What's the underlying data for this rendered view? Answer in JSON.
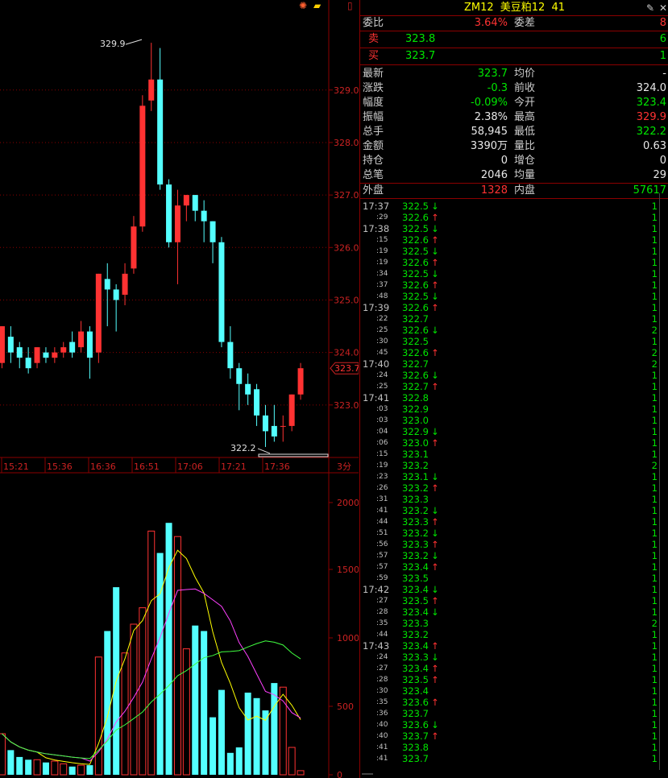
{
  "toolbar": {
    "icons": [
      "settings-icon",
      "gold-icon",
      "menu-icon"
    ]
  },
  "header": {
    "code": "ZM12",
    "name": "美豆粕12",
    "count": "41"
  },
  "order_book": {
    "ratio_label": "委比",
    "ratio_value": "3.64%",
    "diff_label": "委差",
    "diff_value": "8",
    "sell_label": "卖",
    "sell_price": "323.8",
    "sell_vol": "6",
    "buy_label": "买",
    "buy_price": "323.7",
    "buy_vol": "1"
  },
  "quote": [
    {
      "l1": "最新",
      "v1": "323.7",
      "c1": "green",
      "l2": "均价",
      "v2": "-",
      "c2": "white"
    },
    {
      "l1": "涨跌",
      "v1": "-0.3",
      "c1": "green",
      "l2": "前收",
      "v2": "324.0",
      "c2": "white"
    },
    {
      "l1": "幅度",
      "v1": "-0.09%",
      "c1": "green",
      "l2": "今开",
      "v2": "323.4",
      "c2": "green"
    },
    {
      "l1": "振幅",
      "v1": "2.38%",
      "c1": "white",
      "l2": "最高",
      "v2": "329.9",
      "c2": "red"
    },
    {
      "l1": "总手",
      "v1": "58,945",
      "c1": "white",
      "l2": "最低",
      "v2": "322.2",
      "c2": "green"
    },
    {
      "l1": "金额",
      "v1": "3390万",
      "c1": "white",
      "l2": "量比",
      "v2": "0.63",
      "c2": "white"
    },
    {
      "l1": "持仓",
      "v1": "0",
      "c1": "white",
      "l2": "增仓",
      "v2": "0",
      "c2": "white"
    },
    {
      "l1": "总笔",
      "v1": "2046",
      "c1": "white",
      "l2": "均量",
      "v2": "29",
      "c2": "white"
    }
  ],
  "outer_inner": {
    "outer_label": "外盘",
    "outer_value": "1328",
    "inner_label": "内盘",
    "inner_value": "57617"
  },
  "ticks": [
    {
      "t": "17:37",
      "p": "322.5",
      "d": "↓",
      "v": "1"
    },
    {
      "t": ":29",
      "p": "322.6",
      "d": "↑",
      "v": "1"
    },
    {
      "t": "17:38",
      "p": "322.5",
      "d": "↓",
      "v": "1"
    },
    {
      "t": ":15",
      "p": "322.6",
      "d": "↑",
      "v": "1"
    },
    {
      "t": ":19",
      "p": "322.5",
      "d": "↓",
      "v": "1"
    },
    {
      "t": ":19",
      "p": "322.6",
      "d": "↑",
      "v": "1"
    },
    {
      "t": ":34",
      "p": "322.5",
      "d": "↓",
      "v": "1"
    },
    {
      "t": ":37",
      "p": "322.6",
      "d": "↑",
      "v": "1"
    },
    {
      "t": ":48",
      "p": "322.5",
      "d": "↓",
      "v": "1"
    },
    {
      "t": "17:39",
      "p": "322.6",
      "d": "↑",
      "v": "1"
    },
    {
      "t": ":22",
      "p": "322.7",
      "d": "",
      "v": "1"
    },
    {
      "t": ":25",
      "p": "322.6",
      "d": "↓",
      "v": "2"
    },
    {
      "t": ":30",
      "p": "322.5",
      "d": "",
      "v": "1"
    },
    {
      "t": ":45",
      "p": "322.6",
      "d": "↑",
      "v": "2"
    },
    {
      "t": "17:40",
      "p": "322.7",
      "d": "",
      "v": "2"
    },
    {
      "t": ":24",
      "p": "322.6",
      "d": "↓",
      "v": "1"
    },
    {
      "t": ":25",
      "p": "322.7",
      "d": "↑",
      "v": "1"
    },
    {
      "t": "17:41",
      "p": "322.8",
      "d": "",
      "v": "1"
    },
    {
      "t": ":03",
      "p": "322.9",
      "d": "",
      "v": "1"
    },
    {
      "t": ":03",
      "p": "323.0",
      "d": "",
      "v": "1"
    },
    {
      "t": ":04",
      "p": "322.9",
      "d": "↓",
      "v": "1"
    },
    {
      "t": ":06",
      "p": "323.0",
      "d": "↑",
      "v": "1"
    },
    {
      "t": ":15",
      "p": "323.1",
      "d": "",
      "v": "1"
    },
    {
      "t": ":19",
      "p": "323.2",
      "d": "",
      "v": "2"
    },
    {
      "t": ":23",
      "p": "323.1",
      "d": "↓",
      "v": "1"
    },
    {
      "t": ":26",
      "p": "323.2",
      "d": "↑",
      "v": "1"
    },
    {
      "t": ":31",
      "p": "323.3",
      "d": "",
      "v": "1"
    },
    {
      "t": ":41",
      "p": "323.2",
      "d": "↓",
      "v": "1"
    },
    {
      "t": ":44",
      "p": "323.3",
      "d": "↑",
      "v": "1"
    },
    {
      "t": ":51",
      "p": "323.2",
      "d": "↓",
      "v": "1"
    },
    {
      "t": ":56",
      "p": "323.3",
      "d": "↑",
      "v": "1"
    },
    {
      "t": ":57",
      "p": "323.2",
      "d": "↓",
      "v": "1"
    },
    {
      "t": ":57",
      "p": "323.4",
      "d": "↑",
      "v": "1"
    },
    {
      "t": ":59",
      "p": "323.5",
      "d": "",
      "v": "1"
    },
    {
      "t": "17:42",
      "p": "323.4",
      "d": "↓",
      "v": "1"
    },
    {
      "t": ":27",
      "p": "323.5",
      "d": "↑",
      "v": "1"
    },
    {
      "t": ":28",
      "p": "323.4",
      "d": "↓",
      "v": "1"
    },
    {
      "t": ":35",
      "p": "323.3",
      "d": "",
      "v": "2"
    },
    {
      "t": ":44",
      "p": "323.2",
      "d": "",
      "v": "1"
    },
    {
      "t": "17:43",
      "p": "323.4",
      "d": "↑",
      "v": "1"
    },
    {
      "t": ":24",
      "p": "323.3",
      "d": "↓",
      "v": "1"
    },
    {
      "t": ":27",
      "p": "323.4",
      "d": "↑",
      "v": "1"
    },
    {
      "t": ":28",
      "p": "323.5",
      "d": "↑",
      "v": "1"
    },
    {
      "t": ":30",
      "p": "323.4",
      "d": "",
      "v": "1"
    },
    {
      "t": ":35",
      "p": "323.6",
      "d": "↑",
      "v": "1"
    },
    {
      "t": ":36",
      "p": "323.7",
      "d": "",
      "v": "1"
    },
    {
      "t": ":40",
      "p": "323.6",
      "d": "↓",
      "v": "1"
    },
    {
      "t": ":40",
      "p": "323.7",
      "d": "↑",
      "v": "1"
    },
    {
      "t": ":41",
      "p": "323.8",
      "d": "",
      "v": "1"
    },
    {
      "t": ":41",
      "p": "323.7",
      "d": "",
      "v": "1"
    }
  ],
  "colors": {
    "up": "#ff3232",
    "down": "#54ffff",
    "grid": "#8b0000",
    "axis_text": "#cc2222"
  },
  "chart_data": {
    "type": "candlestick",
    "price_axis": {
      "ticks": [
        "329.0",
        "328.0",
        "327.0",
        "326.0",
        "325.0",
        "324.0",
        "323.0"
      ],
      "ylim": [
        322.0,
        329.9
      ],
      "current": "323.7"
    },
    "time_labels": [
      "15:21",
      "15:36",
      "16:36",
      "16:51",
      "17:06",
      "17:21",
      "17:36"
    ],
    "period_label": "3分",
    "high_label": "329.9",
    "low_label": "322.2",
    "volume_axis": {
      "ticks": [
        "2000",
        "1500",
        "1000",
        "500",
        "0"
      ],
      "ylim": [
        0,
        2100
      ]
    },
    "candles": [
      {
        "o": 323.8,
        "h": 323.9,
        "c": 324.5,
        "l": 323.7
      },
      {
        "o": 324.3,
        "h": 324.5,
        "c": 324.0,
        "l": 323.8
      },
      {
        "o": 324.1,
        "h": 324.2,
        "c": 323.9,
        "l": 323.7
      },
      {
        "o": 323.9,
        "h": 324.1,
        "c": 323.7,
        "l": 323.6
      },
      {
        "o": 323.8,
        "h": 324.0,
        "c": 324.1,
        "l": 323.7
      },
      {
        "o": 324.0,
        "h": 324.1,
        "c": 323.9,
        "l": 323.8
      },
      {
        "o": 323.9,
        "h": 324.1,
        "c": 324.0,
        "l": 323.8
      },
      {
        "o": 324.0,
        "h": 324.2,
        "c": 324.1,
        "l": 323.9
      },
      {
        "o": 324.2,
        "h": 324.4,
        "c": 324.0,
        "l": 323.9
      },
      {
        "o": 324.1,
        "h": 324.6,
        "c": 324.4,
        "l": 324.0
      },
      {
        "o": 324.4,
        "h": 324.5,
        "c": 323.9,
        "l": 323.5
      },
      {
        "o": 324.0,
        "h": 325.5,
        "c": 325.5,
        "l": 323.8
      },
      {
        "o": 325.4,
        "h": 325.7,
        "c": 325.2,
        "l": 324.5
      },
      {
        "o": 325.2,
        "h": 325.3,
        "c": 325.0,
        "l": 324.4
      },
      {
        "o": 325.1,
        "h": 325.7,
        "c": 325.5,
        "l": 324.9
      },
      {
        "o": 325.6,
        "h": 326.6,
        "c": 326.4,
        "l": 325.5
      },
      {
        "o": 326.4,
        "h": 328.9,
        "c": 328.7,
        "l": 326.3
      },
      {
        "o": 328.8,
        "h": 329.9,
        "c": 329.2,
        "l": 328.6
      },
      {
        "o": 329.2,
        "h": 329.8,
        "c": 327.2,
        "l": 327.1
      },
      {
        "o": 327.2,
        "h": 327.3,
        "c": 326.1,
        "l": 326.0
      },
      {
        "o": 326.1,
        "h": 327.1,
        "c": 326.8,
        "l": 325.3
      },
      {
        "o": 326.8,
        "h": 327.0,
        "c": 327.0,
        "l": 326.5
      },
      {
        "o": 327.0,
        "h": 327.0,
        "c": 326.7,
        "l": 326.5
      },
      {
        "o": 326.7,
        "h": 326.9,
        "c": 326.5,
        "l": 326.1
      },
      {
        "o": 326.5,
        "h": 326.4,
        "c": 326.1,
        "l": 325.7
      },
      {
        "o": 326.1,
        "h": 326.2,
        "c": 324.2,
        "l": 324.1
      },
      {
        "o": 324.2,
        "h": 324.5,
        "c": 323.7,
        "l": 323.5
      },
      {
        "o": 323.7,
        "h": 323.8,
        "c": 323.4,
        "l": 322.9
      },
      {
        "o": 323.4,
        "h": 323.6,
        "c": 323.2,
        "l": 323.0
      },
      {
        "o": 323.3,
        "h": 323.4,
        "c": 322.8,
        "l": 322.6
      },
      {
        "o": 322.8,
        "h": 323.0,
        "c": 322.5,
        "l": 322.2
      },
      {
        "o": 322.6,
        "h": 323.0,
        "c": 322.4,
        "l": 322.3
      },
      {
        "o": 322.6,
        "h": 322.8,
        "c": 322.6,
        "l": 322.3
      },
      {
        "o": 322.6,
        "h": 323.2,
        "c": 323.2,
        "l": 322.5
      },
      {
        "o": 323.2,
        "h": 323.8,
        "c": 323.7,
        "l": 323.1
      }
    ],
    "volumes": [
      300,
      180,
      130,
      110,
      110,
      90,
      100,
      80,
      60,
      70,
      70,
      860,
      1050,
      1370,
      890,
      1100,
      1220,
      1780,
      1620,
      1840,
      1740,
      920,
      1090,
      1050,
      420,
      620,
      160,
      200,
      600,
      560,
      470,
      670,
      640,
      200,
      30
    ]
  }
}
